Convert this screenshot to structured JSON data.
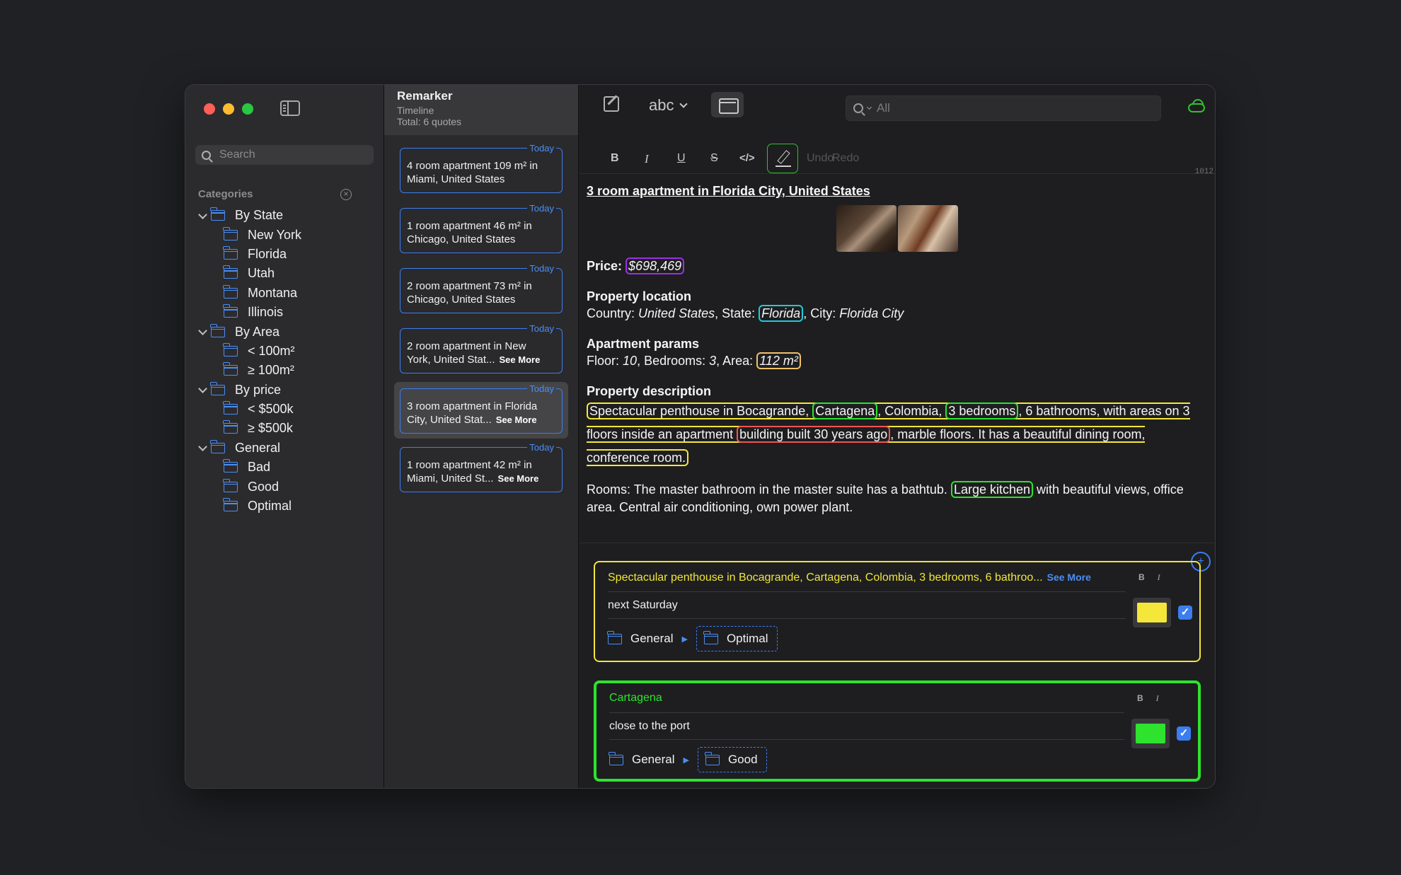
{
  "sidebar": {
    "search_placeholder": "Search",
    "categories_header": "Categories",
    "tree": [
      {
        "label": "By State",
        "level": 0,
        "expanded": true
      },
      {
        "label": "New York",
        "level": 1
      },
      {
        "label": "Florida",
        "level": 1
      },
      {
        "label": "Utah",
        "level": 1
      },
      {
        "label": "Montana",
        "level": 1
      },
      {
        "label": "Illinois",
        "level": 1
      },
      {
        "label": "By Area",
        "level": 0,
        "expanded": true
      },
      {
        "label": "< 100m²",
        "level": 1
      },
      {
        "label": "≥ 100m²",
        "level": 1
      },
      {
        "label": "By price",
        "level": 0,
        "expanded": true
      },
      {
        "label": "< $500k",
        "level": 1
      },
      {
        "label": "≥ $500k",
        "level": 1
      },
      {
        "label": "General",
        "level": 0,
        "expanded": true
      },
      {
        "label": "Bad",
        "level": 1
      },
      {
        "label": "Good",
        "level": 1
      },
      {
        "label": "Optimal",
        "level": 1
      }
    ]
  },
  "timeline": {
    "app_title": "Remarker",
    "subtitle": "Timeline",
    "total": "Total: 6 quotes",
    "cards": [
      {
        "date": "Today",
        "line1": "4 room apartment 109 m² in",
        "line2": "Miami, United States",
        "see_more": ""
      },
      {
        "date": "Today",
        "line1": "1 room apartment 46 m² in",
        "line2": "Chicago, United States",
        "see_more": ""
      },
      {
        "date": "Today",
        "line1": "2 room apartment 73 m² in",
        "line2": "Chicago, United States",
        "see_more": ""
      },
      {
        "date": "Today",
        "line1": "2 room apartment in New",
        "line2": "York, United Stat...",
        "see_more": "See More"
      },
      {
        "date": "Today",
        "line1": "3 room apartment in Florida",
        "line2": "City, United Stat...",
        "see_more": "See More",
        "selected": true
      },
      {
        "date": "Today",
        "line1": "1 room apartment 42 m² in",
        "line2": "Miami, United St...",
        "see_more": "See More"
      }
    ]
  },
  "toolbar": {
    "abc_label": "abc",
    "search_placeholder": "All"
  },
  "format_bar": {
    "bold": "B",
    "italic": "I",
    "underline": "U",
    "strike": "S",
    "code": "</>",
    "undo": "Undo",
    "redo": "Redo",
    "char_count": "1012"
  },
  "document": {
    "title": "3 room apartment in Florida City, United States",
    "price_label": "Price:",
    "price_value": "$698,469",
    "location_heading": "Property location",
    "country_label": "Country:",
    "country_value": "United States",
    "state_label": ", State:",
    "state_value": "Florida",
    "city_label": ", City:",
    "city_value": "Florida City",
    "params_heading": "Apartment params",
    "floor_label": "Floor:",
    "floor_value": "10",
    "bedrooms_label": ", Bedrooms:",
    "bedrooms_value": "3",
    "area_label": ", Area:",
    "area_value": "112 m²",
    "description_heading": "Property description",
    "desc_part1": "Spectacular penthouse in Bocagrande, ",
    "desc_cartagena": "Cartagena",
    "desc_part2": ", Colombia, ",
    "desc_bedrooms": "3 bedrooms",
    "desc_part3": ", 6 bathrooms, with areas on 3 floors inside an apartment ",
    "desc_building": "building built 30 years ago",
    "desc_part4": ", marble floors. It has a beautiful dining room, conference room.",
    "rooms_part1": "Rooms: The master bathroom in the master suite has a bathtub. ",
    "rooms_kitchen": "Large kitchen",
    "rooms_part2": " with beautiful views, office area. Central air conditioning, own power plant."
  },
  "notes": [
    {
      "quote": "Spectacular penthouse in Bocagrande, Cartagena, Colombia, 3 bedrooms, 6 bathroo...",
      "see_more": "See More",
      "comment": "next Saturday",
      "path_parent": "General",
      "path_child": "Optimal",
      "color": "#f5e63a",
      "bold": "B",
      "italic": "I"
    },
    {
      "quote": "Cartagena",
      "see_more": "",
      "comment": "close to the port",
      "path_parent": "General",
      "path_child": "Good",
      "color": "#2ee22e",
      "bold": "B",
      "italic": "I"
    }
  ]
}
